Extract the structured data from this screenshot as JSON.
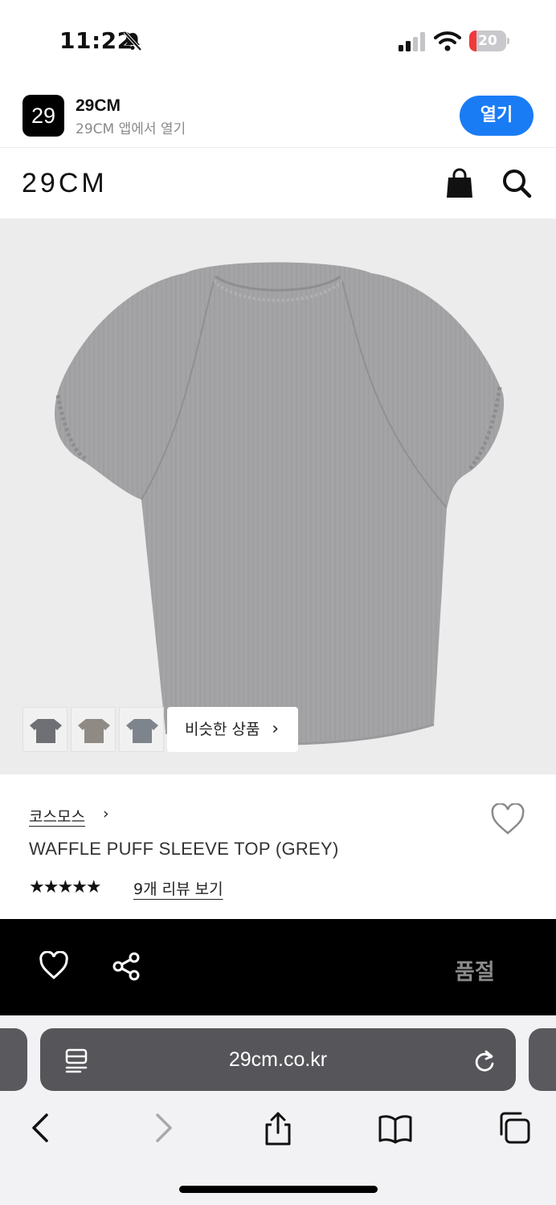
{
  "status_bar": {
    "time": "11:22",
    "battery_level": "20",
    "battery_fraction": 0.2,
    "icons": [
      "bell-slash-icon",
      "cellular-signal-icon",
      "wifi-icon",
      "battery-icon"
    ]
  },
  "app_banner": {
    "logo_text": "29",
    "app_name": "29CM",
    "subtitle": "29CM 앱에서 열기",
    "open_label": "열기",
    "accent": "#1a7cf5"
  },
  "header": {
    "logo": "29CM",
    "icons": [
      "shopping-bag-icon",
      "search-icon"
    ]
  },
  "product_image": {
    "background": "#ececed",
    "similar_label": "비슷한 상품",
    "similar_chevron": "›",
    "thumbnail_count": 3
  },
  "product": {
    "brand": "코스모스",
    "brand_chevron": "›",
    "title": "WAFFLE PUFF SLEEVE TOP (GREY)",
    "rating_stars": "★★★★★",
    "rating": 5,
    "review_link": "9개 리뷰 보기"
  },
  "action_bar": {
    "soldout_label": "품절",
    "icons": [
      "heart-icon",
      "share-icon"
    ]
  },
  "browser": {
    "url": "29cm.co.kr",
    "icons": [
      "reader-icon",
      "reload-icon",
      "back-icon",
      "forward-icon",
      "share-icon",
      "bookmarks-icon",
      "tabs-icon"
    ]
  }
}
